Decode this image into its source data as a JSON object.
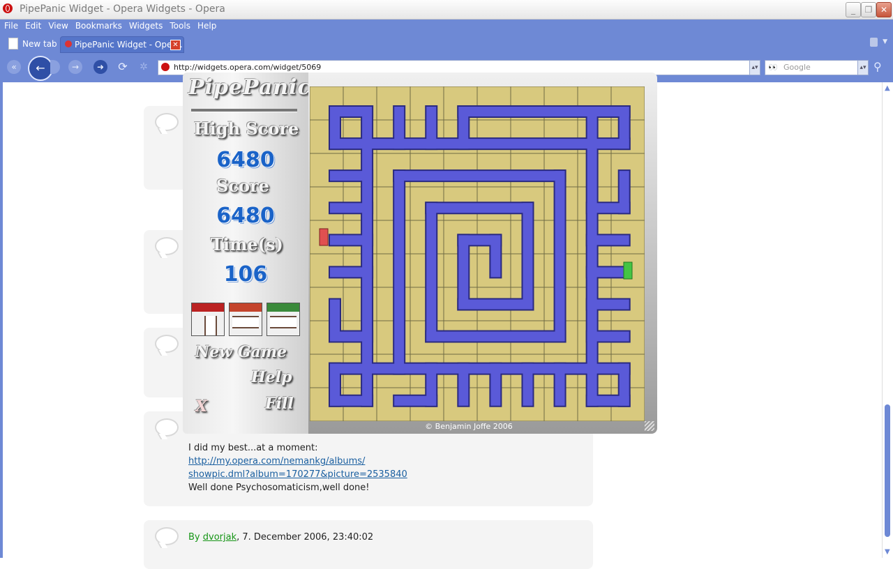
{
  "window": {
    "title": "PipePanic Widget - Opera Widgets - Opera",
    "controls": [
      "minimize",
      "restore",
      "close"
    ]
  },
  "menu": [
    "File",
    "Edit",
    "View",
    "Bookmarks",
    "Widgets",
    "Tools",
    "Help"
  ],
  "tabs": [
    {
      "label": "New tab",
      "active": false,
      "icon": "document-icon"
    },
    {
      "label": "PipePanic Widget - Oper...",
      "active": true,
      "icon": "opera-icon"
    }
  ],
  "nav": {
    "address": "http://widgets.opera.com/widget/5069",
    "search_placeholder": "Google"
  },
  "comments": [
    {
      "lines": [
        "I did my best...at a moment:"
      ],
      "link_lines": [
        "http://my.opera.com/nemankg/albums/",
        "showpic.dml?album=170277&picture=2535840"
      ],
      "after": "Well done Psychosomaticism,well done!"
    },
    {
      "by": "By",
      "author": "dvorjak",
      "date": ", 7. December 2006, 23:40:02"
    }
  ],
  "widget": {
    "logo": "PipePanic",
    "high_score_label": "High Score",
    "high_score": "6480",
    "score_label": "Score",
    "score": "6480",
    "time_label": "Time(s)",
    "time": "106",
    "new_game_label": "New Game",
    "help_label": "Help",
    "fill_label": "Fill",
    "close_label": "X",
    "copyright": "© Benjamin Joffe 2006",
    "colors": {
      "pipe": "#5a5ad8",
      "tile": "#d8c97e",
      "start": "#e05050",
      "end": "#44c444"
    },
    "next_pieces": [
      {
        "type": "corner",
        "cap": "red"
      },
      {
        "type": "straight",
        "cap": "red"
      },
      {
        "type": "straight",
        "cap": "green"
      }
    ]
  }
}
